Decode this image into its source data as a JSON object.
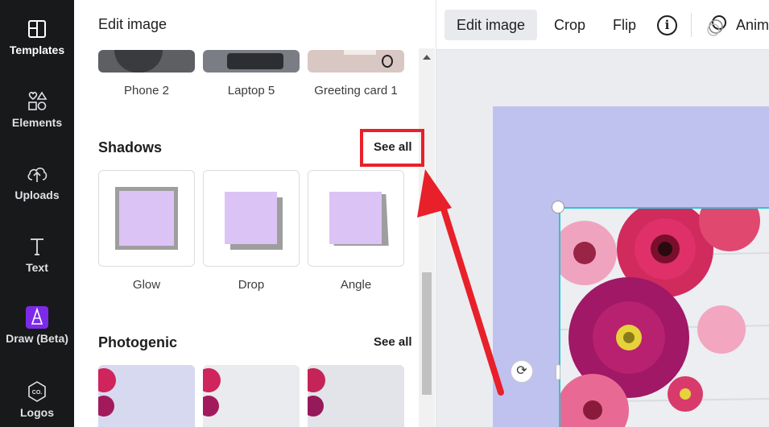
{
  "sidebar": {
    "items": [
      {
        "label": "Templates",
        "icon": "template-icon"
      },
      {
        "label": "Elements",
        "icon": "elements-icon"
      },
      {
        "label": "Uploads",
        "icon": "upload-cloud-icon"
      },
      {
        "label": "Text",
        "icon": "text-icon"
      },
      {
        "label": "Draw (Beta)",
        "icon": "draw-icon"
      },
      {
        "label": "Logos",
        "icon": "logos-icon"
      }
    ]
  },
  "panel": {
    "title": "Edit image",
    "mockups": {
      "items": [
        {
          "label": "Phone 2"
        },
        {
          "label": "Laptop 5"
        },
        {
          "label": "Greeting card 1"
        }
      ]
    },
    "shadows": {
      "title": "Shadows",
      "see_all": "See all",
      "items": [
        {
          "label": "Glow"
        },
        {
          "label": "Drop"
        },
        {
          "label": "Angle"
        }
      ]
    },
    "photogenic": {
      "title": "Photogenic",
      "see_all": "See all"
    }
  },
  "toolbar": {
    "edit_image": "Edit image",
    "crop": "Crop",
    "flip": "Flip",
    "info_icon": "info-icon",
    "animate": "Anim"
  },
  "colors": {
    "sidebar_bg": "#18191b",
    "design_bg": "#bfc2ee",
    "shadow_swatch": "#dcc3f5",
    "highlight": "#e8202a",
    "selection": "#2ec4d6"
  }
}
